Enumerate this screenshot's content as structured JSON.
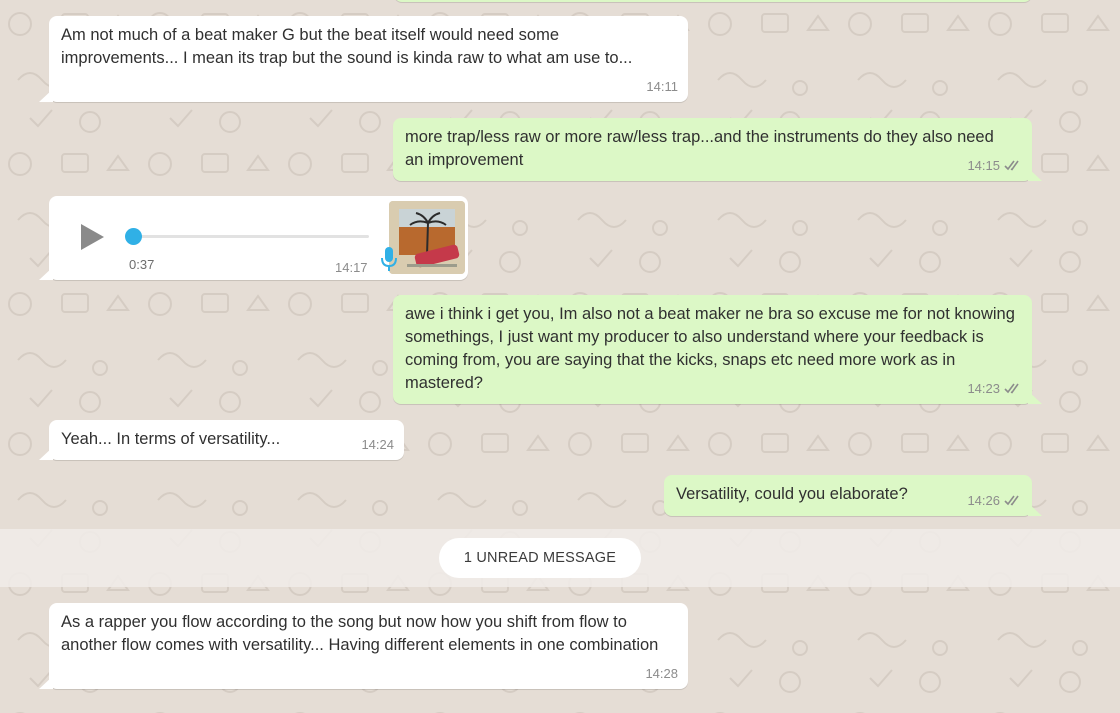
{
  "messages": [
    {
      "text": "Am not much of a beat maker G but the beat itself would need some improvements... I mean its trap but the sound is kinda raw to what am use to...",
      "time": "14:11"
    },
    {
      "text": "more trap/less raw or more raw/less trap...and the instruments do they also need an improvement",
      "time": "14:15"
    },
    {
      "voice_duration": "0:37",
      "time": "14:17"
    },
    {
      "text": "awe i think i get you, Im also not a beat maker ne bra so excuse me for not knowing somethings, I just want my producer to also understand where your feedback is coming from, you are saying that the kicks, snaps etc need more work as in mastered?",
      "time": "14:23"
    },
    {
      "text": "Yeah... In terms of versatility...",
      "time": "14:24"
    },
    {
      "text": "Versatility, could you elaborate?",
      "time": "14:26"
    },
    {
      "text": "As a rapper you flow according to the song but now how you shift from flow to another flow comes with versatility... Having different elements in one combination",
      "time": "14:28"
    }
  ],
  "unread_label": "1 UNREAD MESSAGE",
  "voice_progress": 0.0,
  "icons": [
    "play-icon",
    "microphone-icon",
    "double-check-icon"
  ],
  "colors": {
    "background": "#e5ddd5",
    "incoming_bubble": "#ffffff",
    "outgoing_bubble": "#dcf8c6",
    "read_check": "#8c8c8c",
    "voice_accent": "#30b0e6"
  }
}
